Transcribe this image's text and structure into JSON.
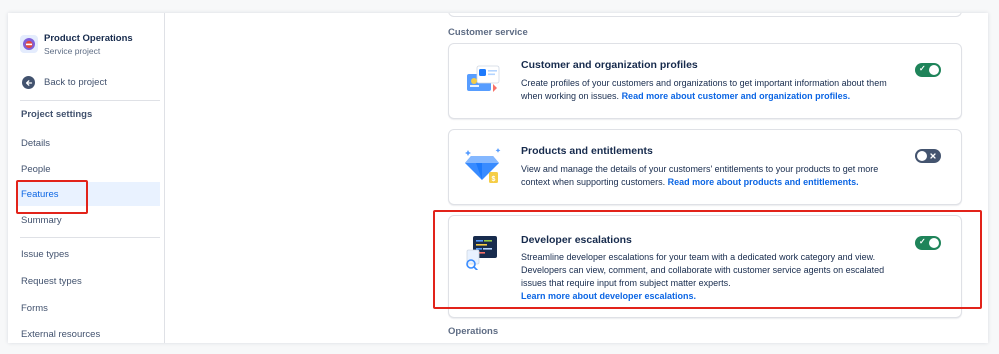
{
  "project": {
    "name": "Product Operations",
    "type": "Service project"
  },
  "sidebar": {
    "back_label": "Back to project",
    "section_title": "Project settings",
    "items": [
      {
        "label": "Details"
      },
      {
        "label": "People"
      },
      {
        "label": "Features"
      },
      {
        "label": "Summary"
      },
      {
        "label": "Issue types"
      },
      {
        "label": "Request types"
      },
      {
        "label": "Forms"
      },
      {
        "label": "External resources"
      }
    ]
  },
  "main": {
    "groups": [
      {
        "label": "Customer service"
      },
      {
        "label": "Operations"
      }
    ],
    "cards": [
      {
        "title": "Customer and organization profiles",
        "description": "Create profiles of your customers and organizations to get important information about them when working on issues. ",
        "link": "Read more about customer and organization profiles.",
        "enabled": true
      },
      {
        "title": "Products and entitlements",
        "description": "View and manage the details of your customers' entitlements to your products to get more context when supporting customers. ",
        "link": "Read more about products and entitlements.",
        "enabled": false
      },
      {
        "title": "Developer escalations",
        "description": "Streamline developer escalations for your team with a dedicated work category and view. Developers can view, comment, and collaborate with customer service agents on escalated issues that require input from subject matter experts.",
        "link": "Learn more about developer escalations.",
        "enabled": true
      }
    ]
  },
  "colors": {
    "active_nav_bg": "#e9f2ff",
    "active_nav_text": "#0c66e4",
    "toggle_on": "#1f845a",
    "toggle_off": "#44546f",
    "link": "#0c66e4",
    "highlight": "#e2231a"
  }
}
